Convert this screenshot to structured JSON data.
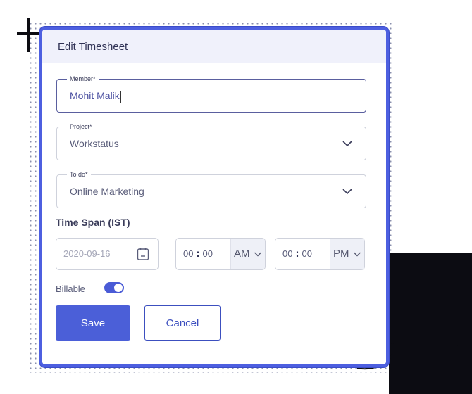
{
  "dialog": {
    "title": "Edit Timesheet"
  },
  "fields": {
    "member": {
      "label": "Member*",
      "value": "Mohit Malik"
    },
    "project": {
      "label": "Project*",
      "value": "Workstatus"
    },
    "todo": {
      "label": "To do*",
      "value": "Online Marketing"
    }
  },
  "time_span": {
    "title": "Time Span (IST)",
    "date": "2020-09-16",
    "start": {
      "hours": "00",
      "minutes": "00",
      "period": "AM"
    },
    "end": {
      "hours": "00",
      "minutes": "00",
      "period": "PM"
    },
    "separator": ":"
  },
  "billable": {
    "label": "Billable",
    "enabled": true
  },
  "actions": {
    "save_label": "Save",
    "cancel_label": "Cancel"
  },
  "colors": {
    "accent": "#4b5fd8",
    "header_bg": "#f0f1fb",
    "modal_border": "#4d5fe0"
  },
  "icons": {
    "dropdown": "chevron-down-icon",
    "calendar": "calendar-icon"
  }
}
